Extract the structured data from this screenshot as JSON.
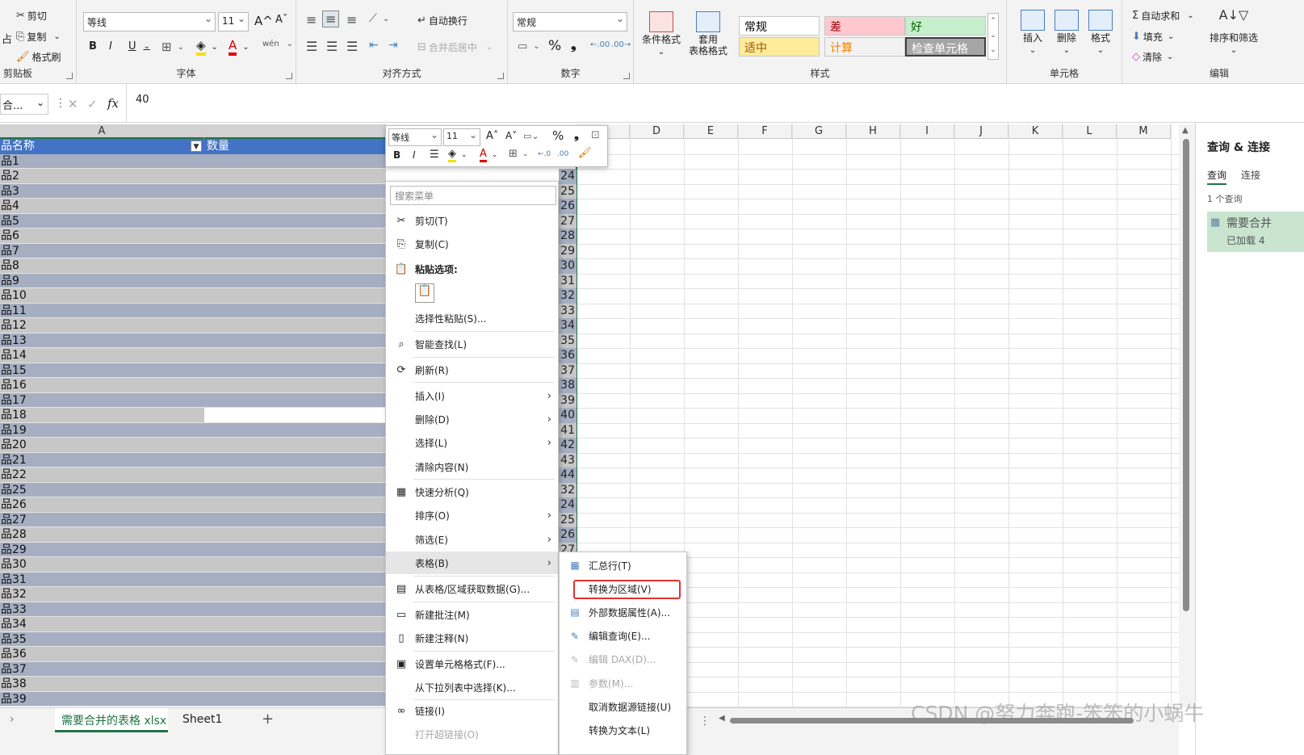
{
  "ribbon": {
    "clipboard": {
      "cut": "剪切",
      "copy": "复制",
      "format_painter": "格式刷",
      "label": "剪贴板",
      "paste_fragment": "占"
    },
    "font": {
      "name": "等线",
      "size": "11",
      "label": "字体",
      "grow": "A^",
      "shrink": "Aˇ",
      "bold": "B",
      "italic": "I",
      "underline": "U",
      "phonetic": "wén"
    },
    "alignment": {
      "wrap": "自动换行",
      "merge": "合并后居中",
      "label": "对齐方式"
    },
    "number": {
      "format": "常规",
      "percent": "%",
      "comma": "❟",
      "label": "数字"
    },
    "styles": {
      "conditional": "条件格式",
      "table_format": "套用\n表格格式",
      "cells": [
        {
          "text": "常规",
          "bg": "#ffffff",
          "color": "#000000"
        },
        {
          "text": "差",
          "bg": "#ffc7ce",
          "color": "#9c0006"
        },
        {
          "text": "好",
          "bg": "#c6efce",
          "color": "#006100"
        },
        {
          "text": "适中",
          "bg": "#ffeb9c",
          "color": "#9c5700"
        },
        {
          "text": "计算",
          "bg": "#f2f2f2",
          "color": "#fa7d00"
        },
        {
          "text": "检查单元格",
          "bg": "#a5a5a5",
          "color": "#ffffff"
        }
      ],
      "label": "样式"
    },
    "cells_group": {
      "insert": "插入",
      "delete": "删除",
      "format": "格式",
      "label": "单元格"
    },
    "editing": {
      "autosum": "自动求和",
      "fill": "填充",
      "clear": "清除",
      "sort_filter": "排序和筛选",
      "label": "编辑"
    }
  },
  "formula_bar": {
    "name_box": "合...",
    "fx": "fx",
    "value": "40"
  },
  "columns": [
    "A",
    "D",
    "E",
    "F",
    "G",
    "H",
    "I",
    "J",
    "K",
    "L",
    "M"
  ],
  "table": {
    "headers": [
      "品名称",
      "数量"
    ],
    "rows": [
      "品1",
      "品2",
      "品3",
      "品4",
      "品5",
      "品6",
      "品7",
      "品8",
      "品9",
      "品10",
      "品11",
      "品12",
      "品13",
      "品14",
      "品15",
      "品16",
      "品17",
      "品18",
      "品19",
      "品20",
      "品21",
      "品22",
      "品25",
      "品26",
      "品27",
      "品28",
      "品29",
      "品30",
      "品31",
      "品32",
      "品33",
      "品34",
      "品35",
      "品36",
      "品37",
      "品38",
      "品39"
    ],
    "peek_values": [
      "24",
      "25",
      "26",
      "27",
      "28",
      "29",
      "30",
      "31",
      "32",
      "33",
      "34",
      "35",
      "36",
      "37",
      "38",
      "39",
      "40",
      "41",
      "42",
      "43",
      "44",
      "32",
      "24",
      "25",
      "26",
      "27"
    ]
  },
  "mini_toolbar": {
    "font": "等线",
    "size": "11"
  },
  "context_menu": {
    "search_placeholder": "搜索菜单",
    "items": [
      {
        "label": "剪切(T)",
        "icon": "scissors-icon",
        "glyph": "✂"
      },
      {
        "label": "复制(C)",
        "icon": "copy-icon",
        "glyph": "⎘"
      },
      {
        "label": "粘贴选项:",
        "icon": "paste-icon",
        "glyph": "📋"
      },
      {
        "label": "选择性粘贴(S)...",
        "icon": "",
        "glyph": ""
      },
      {
        "label": "智能查找(L)",
        "icon": "search-icon",
        "glyph": "⌕"
      },
      {
        "label": "刷新(R)",
        "icon": "refresh-icon",
        "glyph": "⟳"
      },
      {
        "label": "插入(I)",
        "icon": "",
        "glyph": ""
      },
      {
        "label": "删除(D)",
        "icon": "",
        "glyph": ""
      },
      {
        "label": "选择(L)",
        "icon": "",
        "glyph": ""
      },
      {
        "label": "清除内容(N)",
        "icon": "",
        "glyph": ""
      },
      {
        "label": "快速分析(Q)",
        "icon": "quick-analysis-icon",
        "glyph": "▦"
      },
      {
        "label": "排序(O)",
        "icon": "",
        "glyph": ""
      },
      {
        "label": "筛选(E)",
        "icon": "",
        "glyph": ""
      },
      {
        "label": "表格(B)",
        "icon": "",
        "glyph": ""
      },
      {
        "label": "从表格/区域获取数据(G)...",
        "icon": "table-icon",
        "glyph": "▤"
      },
      {
        "label": "新建批注(M)",
        "icon": "comment-icon",
        "glyph": "▭"
      },
      {
        "label": "新建注释(N)",
        "icon": "note-icon",
        "glyph": "▯"
      },
      {
        "label": "设置单元格格式(F)...",
        "icon": "format-cells-icon",
        "glyph": "▣"
      },
      {
        "label": "从下拉列表中选择(K)...",
        "icon": "",
        "glyph": ""
      },
      {
        "label": "链接(I)",
        "icon": "link-icon",
        "glyph": "∞"
      },
      {
        "label": "打开超链接(O)",
        "icon": "",
        "glyph": ""
      }
    ]
  },
  "submenu": {
    "items": [
      {
        "label": "汇总行(T)",
        "glyph": "▦",
        "disabled": false
      },
      {
        "label": "转换为区域(V)",
        "glyph": "",
        "disabled": false
      },
      {
        "label": "外部数据属性(A)...",
        "glyph": "▤",
        "disabled": false
      },
      {
        "label": "编辑查询(E)...",
        "glyph": "✎",
        "disabled": false
      },
      {
        "label": "编辑 DAX(D)...",
        "glyph": "✎",
        "disabled": true
      },
      {
        "label": "参数(M)...",
        "glyph": "▥",
        "disabled": true
      },
      {
        "label": "取消数据源链接(U)",
        "glyph": "",
        "disabled": false
      },
      {
        "label": "转换为文本(L)",
        "glyph": "",
        "disabled": false
      }
    ]
  },
  "query_pane": {
    "title": "查询 & 连接",
    "tab_queries": "查询",
    "tab_connections": "连接",
    "count": "1 个查询",
    "query_name": "需要合并",
    "query_status": "已加载 4"
  },
  "sheets": {
    "tabs": [
      "需要合并的表格 xlsx",
      "Sheet1"
    ],
    "add": "+"
  },
  "watermark": "CSDN @努力奔跑-笨笨的小蜗牛",
  "colors": {
    "accent": "#217346",
    "table_band_dark": "#a6afc2",
    "table_band_light": "#c7c7c7",
    "table_header": "#4472c4",
    "highlight": "#e0342d"
  }
}
